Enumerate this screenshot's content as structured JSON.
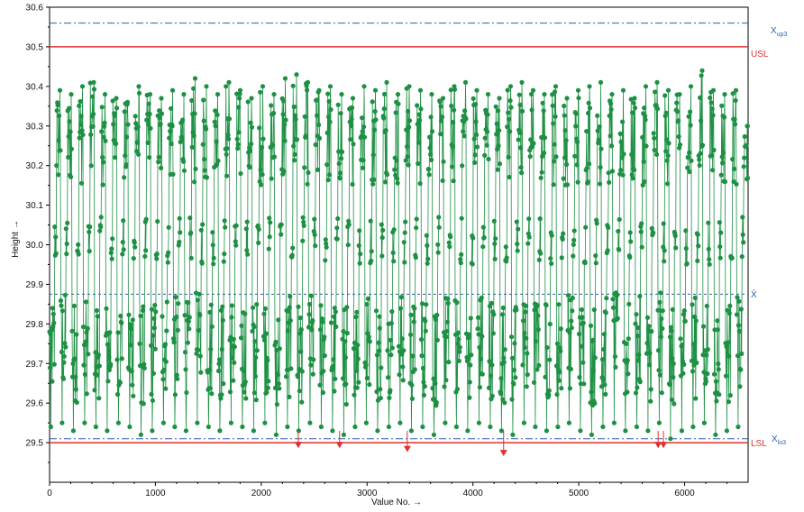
{
  "chart_data": {
    "type": "line",
    "title": "",
    "xlabel": "Value No. →",
    "ylabel": "Height →",
    "xlim": [
      0,
      6600
    ],
    "ylim": [
      29.4,
      30.6
    ],
    "x_ticks": [
      0,
      1000,
      2000,
      3000,
      4000,
      5000,
      6000
    ],
    "x_tick_labels": [
      "0",
      "1000",
      "2000",
      "3000",
      "4000",
      "5000",
      "6000"
    ],
    "y_ticks": [
      29.5,
      29.6,
      29.7,
      29.8,
      29.9,
      30.0,
      30.1,
      30.2,
      30.3,
      30.4,
      30.5,
      30.6
    ],
    "y_tick_labels": [
      "29.5",
      "29.6",
      "29.7",
      "29.8",
      "29.9",
      "30.0",
      "30.1",
      "30.2",
      "30.3",
      "30.4",
      "30.5",
      "30.6"
    ],
    "grid": false,
    "limit_lines": [
      {
        "label": "USL",
        "value": 30.5,
        "style": "solid",
        "color": "#e03030"
      },
      {
        "label": "LSL",
        "value": 29.5,
        "style": "solid",
        "color": "#e03030"
      },
      {
        "label": "Xup3",
        "value": 30.56,
        "style": "dashdot",
        "color": "#2f5fa8"
      },
      {
        "label": "Xlo3",
        "value": 29.51,
        "style": "dashdot",
        "color": "#2f5fa8"
      },
      {
        "label": "X̄",
        "value": 29.875,
        "style": "dashed",
        "color": "#2f5fa8"
      }
    ],
    "series": [
      {
        "color": "#1e9044",
        "marker": "circle",
        "description_x_range": [
          0,
          6600
        ],
        "cycle_count": 62,
        "cycle_peaks": [
          30.39,
          30.38,
          30.4,
          30.41,
          30.38,
          30.37,
          30.36,
          30.4,
          30.38,
          30.37,
          30.39,
          30.38,
          30.42,
          30.4,
          30.38,
          30.41,
          30.39,
          30.37,
          30.4,
          30.38,
          30.42,
          30.43,
          30.41,
          30.39,
          30.4,
          30.38,
          30.37,
          30.4,
          30.39,
          30.41,
          30.38,
          30.4,
          30.39,
          30.38,
          30.37,
          30.4,
          30.41,
          30.39,
          30.38,
          30.37,
          30.4,
          30.41,
          30.39,
          30.38,
          30.4,
          30.37,
          30.39,
          30.4,
          30.41,
          30.38,
          30.39,
          30.37,
          30.4,
          30.41,
          30.39,
          30.38,
          30.4,
          30.44,
          30.39,
          30.38,
          30.39,
          30.3
        ],
        "cycle_lows": [
          29.54,
          29.55,
          29.53,
          29.55,
          29.54,
          29.53,
          29.55,
          29.54,
          29.52,
          29.53,
          29.55,
          29.54,
          29.53,
          29.55,
          29.54,
          29.53,
          29.55,
          29.54,
          29.53,
          29.55,
          29.52,
          29.54,
          29.53,
          29.55,
          29.54,
          29.53,
          29.52,
          29.54,
          29.55,
          29.53,
          29.54,
          29.55,
          29.53,
          29.54,
          29.52,
          29.55,
          29.54,
          29.53,
          29.55,
          29.54,
          29.53,
          29.52,
          29.55,
          29.54,
          29.53,
          29.54,
          29.55,
          29.53,
          29.52,
          29.54,
          29.55,
          29.53,
          29.54,
          29.53,
          29.55,
          29.51,
          29.53,
          29.54,
          29.55,
          29.52,
          29.53,
          29.54
        ]
      }
    ],
    "violations": [
      {
        "x": 2350,
        "y": 29.495
      },
      {
        "x": 2740,
        "y": 29.495
      },
      {
        "x": 3380,
        "y": 29.485
      },
      {
        "x": 4290,
        "y": 29.475
      },
      {
        "x": 5750,
        "y": 29.495
      },
      {
        "x": 5800,
        "y": 29.495
      }
    ],
    "violation_color": "#e03030"
  },
  "labels": {
    "usl": "USL",
    "lsl": "LSL",
    "xup3_main": "X",
    "xup3_sub": "up3",
    "xlo3_main": "X",
    "xlo3_sub": "lo3",
    "xbar": "X̄"
  }
}
